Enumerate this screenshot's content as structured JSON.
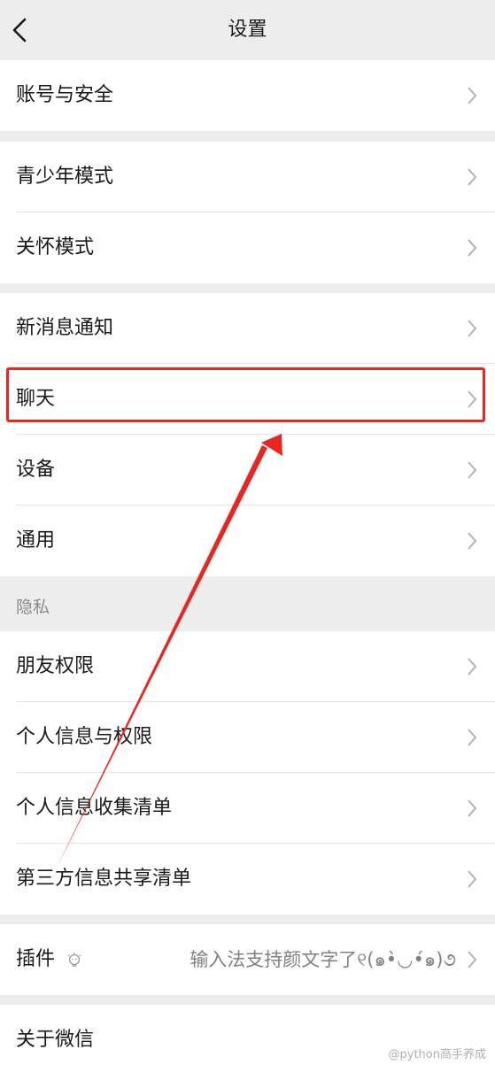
{
  "nav": {
    "title": "设置",
    "back_icon": "chevron-left-icon"
  },
  "groups": {
    "account": {
      "items": [
        {
          "label": "账号与安全"
        }
      ]
    },
    "modes": {
      "items": [
        {
          "label": "青少年模式"
        },
        {
          "label": "关怀模式"
        }
      ]
    },
    "general": {
      "items": [
        {
          "label": "新消息通知"
        },
        {
          "label": "聊天"
        },
        {
          "label": "设备"
        },
        {
          "label": "通用"
        }
      ]
    },
    "privacy": {
      "header": "隐私",
      "items": [
        {
          "label": "朋友权限"
        },
        {
          "label": "个人信息与权限"
        },
        {
          "label": "个人信息收集清单"
        },
        {
          "label": "第三方信息共享清单"
        }
      ]
    },
    "plugins": {
      "items": [
        {
          "label": "插件",
          "icon": "lightbulb-icon",
          "value": "输入法支持颜文字了୧(๑•̀◡•́๑)૭"
        }
      ]
    },
    "about": {
      "items": [
        {
          "label": "关于微信"
        }
      ]
    }
  },
  "annotation": {
    "highlighted_item": "聊天",
    "color": "#e82520"
  },
  "watermark": "@python高手养成",
  "colors": {
    "background": "#ededed",
    "row_background": "#ffffff",
    "text": "#191919",
    "secondary_text": "#808080",
    "chevron": "#b2b2b2"
  }
}
